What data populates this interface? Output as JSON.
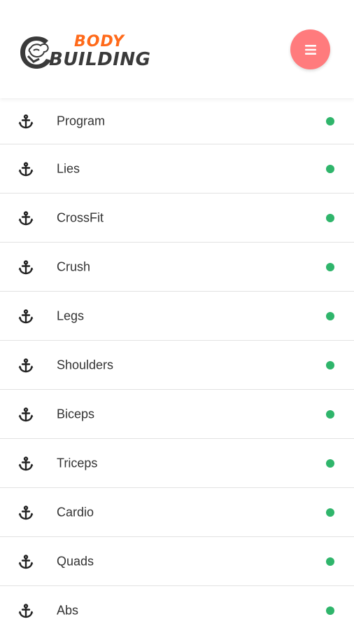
{
  "header": {
    "logo_line1": "BODY",
    "logo_line2": "BUILDING",
    "menu_icon": "hamburger-icon",
    "menu_button_color": "#ff7b7d",
    "logo_accent_color": "#ff6a1a"
  },
  "items": [
    {
      "label": "Program",
      "icon": "anchor-icon",
      "status": "online"
    },
    {
      "label": "Lies",
      "icon": "anchor-icon",
      "status": "online"
    },
    {
      "label": "CrossFit",
      "icon": "anchor-icon",
      "status": "online"
    },
    {
      "label": "Crush",
      "icon": "anchor-icon",
      "status": "online"
    },
    {
      "label": "Legs",
      "icon": "anchor-icon",
      "status": "online"
    },
    {
      "label": "Shoulders",
      "icon": "anchor-icon",
      "status": "online"
    },
    {
      "label": "Biceps",
      "icon": "anchor-icon",
      "status": "online"
    },
    {
      "label": "Triceps",
      "icon": "anchor-icon",
      "status": "online"
    },
    {
      "label": "Cardio",
      "icon": "anchor-icon",
      "status": "online"
    },
    {
      "label": "Quads",
      "icon": "anchor-icon",
      "status": "online"
    },
    {
      "label": "Abs",
      "icon": "anchor-icon",
      "status": "online"
    }
  ],
  "status_dot_color": "#2fb56b"
}
